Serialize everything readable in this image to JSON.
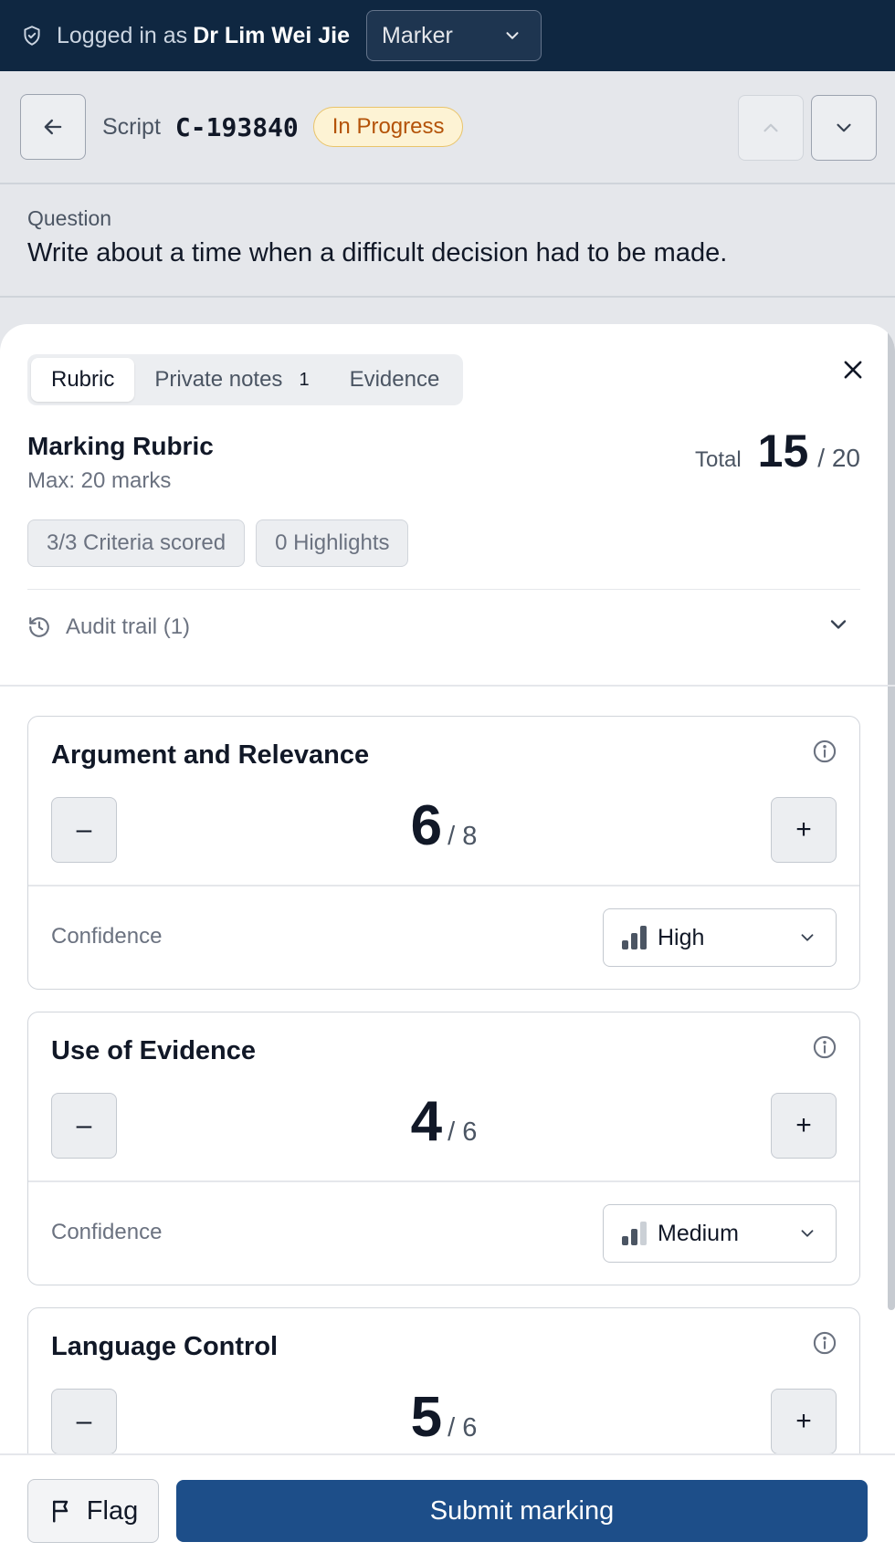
{
  "topbar": {
    "login_prefix": "Logged in as",
    "user_name": "Dr Lim Wei Jie",
    "role": "Marker"
  },
  "script": {
    "label": "Script",
    "id": "C-193840",
    "status": "In Progress"
  },
  "question": {
    "label": "Question",
    "text": "Write about a time when a difficult decision had to be made."
  },
  "tabs": [
    {
      "label": "Rubric",
      "active": true
    },
    {
      "label": "Private notes",
      "count": "1"
    },
    {
      "label": "Evidence"
    }
  ],
  "rubric": {
    "title": "Marking Rubric",
    "max": "Max: 20 marks",
    "total_label": "Total",
    "total": "15",
    "total_max": "/ 20",
    "chips": [
      "3/3 Criteria scored",
      "0 Highlights"
    ],
    "audit": "Audit trail (1)"
  },
  "criteria": [
    {
      "title": "Argument and Relevance",
      "score": "6",
      "max": "/ 8",
      "confidence_label": "Confidence",
      "confidence": "High",
      "confidence_level": 3
    },
    {
      "title": "Use of Evidence",
      "score": "4",
      "max": "/ 6",
      "confidence_label": "Confidence",
      "confidence": "Medium",
      "confidence_level": 2
    },
    {
      "title": "Language Control",
      "score": "5",
      "max": "/ 6"
    }
  ],
  "footer": {
    "flag": "Flag",
    "submit": "Submit marking"
  },
  "colors": {
    "topbar": "#0f2741",
    "primary": "#1d4e89",
    "status_bg": "#fdf3d4",
    "status_text": "#b45309"
  }
}
